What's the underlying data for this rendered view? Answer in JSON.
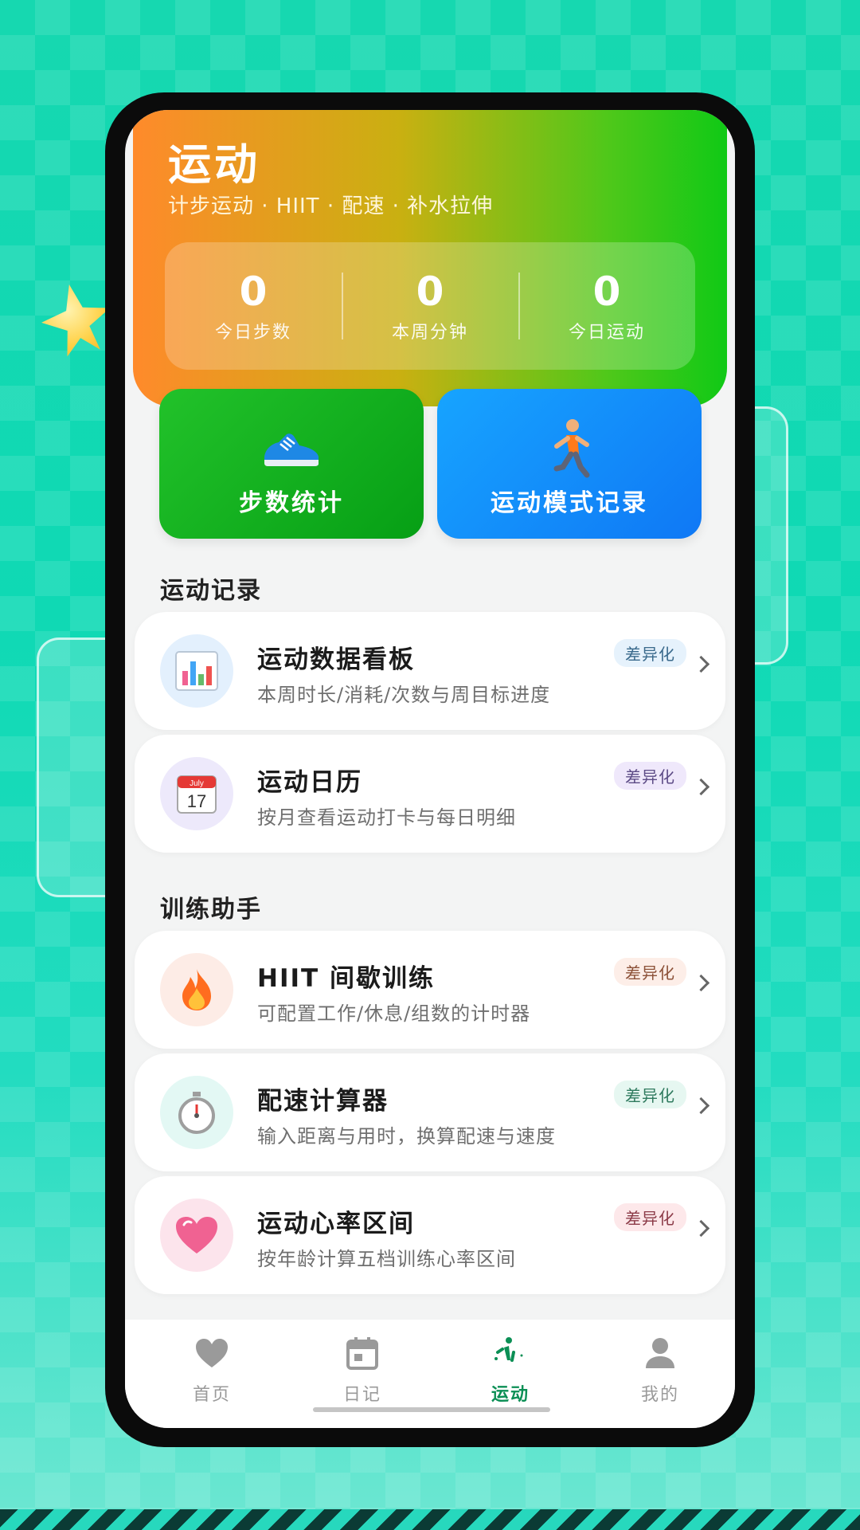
{
  "header": {
    "title": "运动",
    "subtitle": "计步运动 · HIIT · 配速 · 补水拉伸",
    "stats": [
      {
        "value": "0",
        "label": "今日步数"
      },
      {
        "value": "0",
        "label": "本周分钟"
      },
      {
        "value": "0",
        "label": "今日运动"
      }
    ]
  },
  "tiles": [
    {
      "label": "步数统计",
      "icon": "sneaker-icon",
      "color": "#0ea81e"
    },
    {
      "label": "运动模式记录",
      "icon": "runner-icon",
      "color": "#1a8cff"
    }
  ],
  "sections": {
    "records_title": "运动记录",
    "training_title": "训练助手"
  },
  "records": [
    {
      "title": "运动数据看板",
      "desc": "本周时长/消耗/次数与周目标进度",
      "badge": "差异化",
      "icon": "bar-chart-icon"
    },
    {
      "title": "运动日历",
      "desc": "按月查看运动打卡与每日明细",
      "badge": "差异化",
      "icon": "calendar-icon",
      "calendar_month": "July",
      "calendar_day": "17"
    }
  ],
  "training": [
    {
      "title": "HIIT 间歇训练",
      "desc": "可配置工作/休息/组数的计时器",
      "badge": "差异化",
      "icon": "fire-icon"
    },
    {
      "title": "配速计算器",
      "desc": "输入距离与用时，换算配速与速度",
      "badge": "差异化",
      "icon": "stopwatch-icon"
    },
    {
      "title": "运动心率区间",
      "desc": "按年龄计算五档训练心率区间",
      "badge": "差异化",
      "icon": "heart-icon"
    }
  ],
  "tabbar": [
    {
      "label": "首页",
      "icon": "heart-icon",
      "active": false
    },
    {
      "label": "日记",
      "icon": "calendar-icon",
      "active": false
    },
    {
      "label": "运动",
      "icon": "activity-icon",
      "active": true
    },
    {
      "label": "我的",
      "icon": "person-icon",
      "active": false
    }
  ],
  "colors": {
    "header_start": "#ff8a2b",
    "header_end": "#10c916",
    "active_tab": "#0b8f55",
    "background": "#16d8b0"
  }
}
